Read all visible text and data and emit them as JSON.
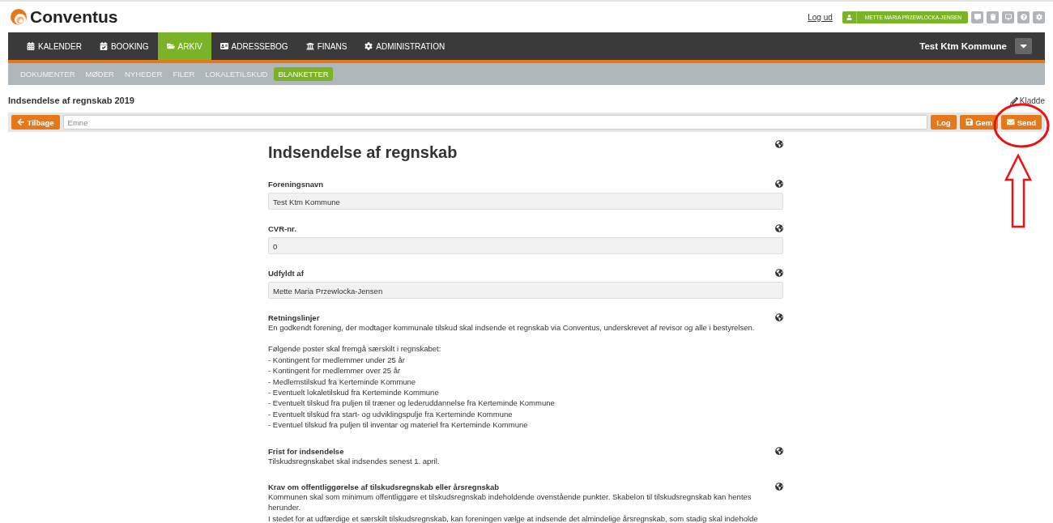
{
  "header": {
    "logo": "Conventus",
    "logout": "Log ud",
    "user": "METTE MARIA PRZEWLOCKA-JENSEN",
    "tools": [
      {
        "kind": "chat"
      },
      {
        "kind": "trash"
      },
      {
        "kind": "screen"
      },
      {
        "kind": "help"
      },
      {
        "kind": "settings"
      }
    ]
  },
  "nav": {
    "items": [
      {
        "label": "KALENDER",
        "selected": false
      },
      {
        "label": "BOOKING",
        "selected": false
      },
      {
        "label": "ARKIV",
        "selected": true
      },
      {
        "label": "ADRESSEBOG",
        "selected": false
      },
      {
        "label": "FINANS",
        "selected": false
      },
      {
        "label": "ADMINISTRATION",
        "selected": false
      }
    ],
    "org": "Test Ktm Kommune"
  },
  "subnav": [
    {
      "label": "DOKUMENTER",
      "selected": false
    },
    {
      "label": "MØDER",
      "selected": false
    },
    {
      "label": "NYHEDER",
      "selected": false
    },
    {
      "label": "FILER",
      "selected": false
    },
    {
      "label": "LOKALETILSKUD",
      "selected": false
    },
    {
      "label": "BLANKETTER",
      "selected": true
    }
  ],
  "page": {
    "title": "Indsendelse af regnskab 2019",
    "status": "Kladde"
  },
  "toolbar": {
    "back": "Tilbage",
    "subject_placeholder": "Emne",
    "buttons": [
      {
        "label": "Log",
        "kind": "log"
      },
      {
        "label": "Gem",
        "kind": "save"
      },
      {
        "label": "Send",
        "kind": "send"
      }
    ]
  },
  "form": {
    "heading": "Indsendelse af regnskab",
    "sections": [
      {
        "kind": "field",
        "label": "Foreningsnavn",
        "value": "Test Ktm Kommune"
      },
      {
        "kind": "field",
        "label": "CVR-nr.",
        "value": "0"
      },
      {
        "kind": "field",
        "label": "Udfyldt af",
        "value": "Mette Maria Przewlocka-Jensen"
      },
      {
        "kind": "text",
        "label": "Retningslinjer",
        "lines": [
          "En godkendt forening, der modtager kommunale tilskud skal indsende et regnskab via Conventus, underskrevet af revisor og alle i bestyrelsen."
        ]
      },
      {
        "kind": "list",
        "lines": [
          "Følgende poster skal fremgå særskilt i regnskabet:",
          "- Kontingent for medlemmer under 25 år",
          "- Kontingent for medlemmer over 25 år",
          "- Medlemstilskud fra Kerteminde Kommune",
          "- Eventuelt lokaletilskud fra Kerteminde Kommune",
          "- Eventuelt tilskud fra puljen til træner og lederuddannelse fra Kerteminde Kommune",
          "- Eventuelt tilskud fra start- og udviklingspulje fra Kerteminde Kommune",
          "- Eventuel tilskud fra puljen til inventar og materiel fra Kerteminde Kommune"
        ]
      },
      {
        "kind": "text",
        "label": "Frist for indsendelse",
        "lines": [
          "Tilskudsregnskabet skal indsendes senest 1. april."
        ]
      },
      {
        "kind": "text",
        "label": "Krav om offentliggørelse af tilskudsregnskab eller årsregnskab",
        "lines": [
          "Kommunen skal som minimum offentliggøre et tilskudsregnskab indeholdende ovenstående punkter. Skabelon til tilskudsregnskab kan hentes herunder.",
          "I stedet for at udfærdige et særskilt tilskudsregnskab, kan foreningen vælge at indsende det almindelige årsregnskab, som stadig skal indeholde"
        ]
      }
    ]
  }
}
